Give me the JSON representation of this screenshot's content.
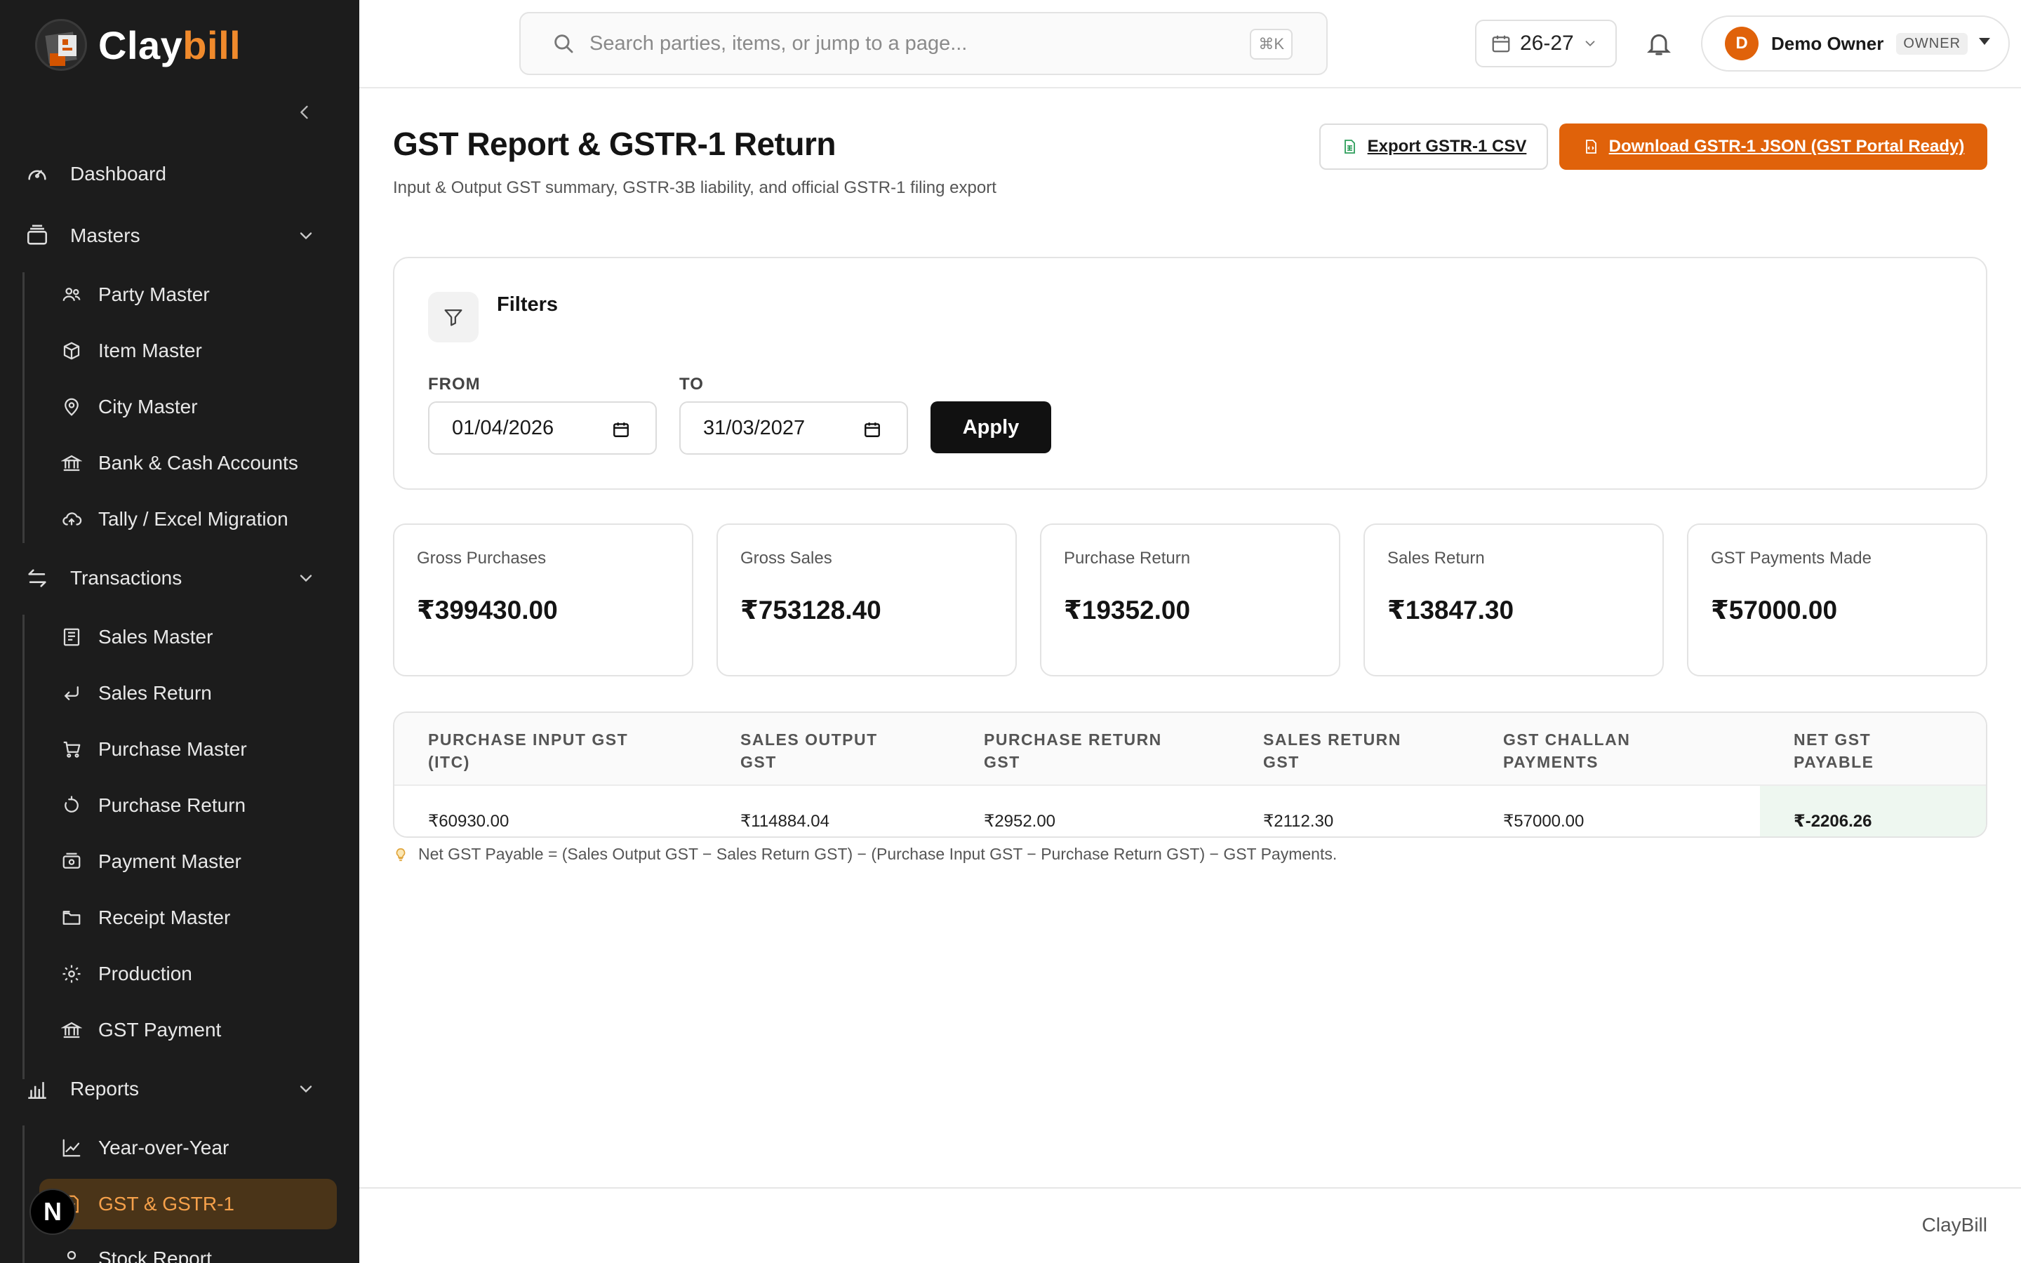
{
  "brand": {
    "name_part1": "Clay",
    "name_part2": "bill"
  },
  "sidebar": {
    "dashboard": "Dashboard",
    "masters": {
      "label": "Masters",
      "items": [
        "Party Master",
        "Item Master",
        "City Master",
        "Bank & Cash Accounts",
        "Tally / Excel Migration"
      ]
    },
    "transactions": {
      "label": "Transactions",
      "items": [
        "Sales Master",
        "Sales Return",
        "Purchase Master",
        "Purchase Return",
        "Payment Master",
        "Receipt Master",
        "Production",
        "GST Payment"
      ]
    },
    "reports": {
      "label": "Reports",
      "items": [
        "Year-over-Year",
        "GST & GSTR-1",
        "Stock Report"
      ]
    },
    "next_badge": "N"
  },
  "topbar": {
    "search_placeholder": "Search parties, items, or jump to a page...",
    "search_shortcut": "⌘K",
    "fiscal_year": "26-27",
    "user": {
      "initial": "D",
      "name": "Demo Owner",
      "role": "OWNER"
    }
  },
  "page": {
    "title": "GST Report & GSTR-1 Return",
    "subtitle": "Input & Output GST summary, GSTR-3B liability, and official GSTR-1 filing export",
    "export_csv_label": "Export GSTR-1 CSV",
    "download_json_label": "Download GSTR-1 JSON (GST Portal Ready)"
  },
  "filters": {
    "title": "Filters",
    "from_label": "FROM",
    "from_value": "01/04/2026",
    "to_label": "TO",
    "to_value": "31/03/2027",
    "apply_label": "Apply"
  },
  "summary_cards": [
    {
      "label": "Gross Purchases",
      "value": "₹399430.00"
    },
    {
      "label": "Gross Sales",
      "value": "₹753128.40"
    },
    {
      "label": "Purchase Return",
      "value": "₹19352.00"
    },
    {
      "label": "Sales Return",
      "value": "₹13847.30"
    },
    {
      "label": "GST Payments Made",
      "value": "₹57000.00"
    }
  ],
  "gst_table": {
    "headers": [
      [
        "PURCHASE INPUT GST",
        "(ITC)"
      ],
      [
        "SALES OUTPUT",
        "GST"
      ],
      [
        "PURCHASE RETURN",
        "GST"
      ],
      [
        "SALES RETURN",
        "GST"
      ],
      [
        "GST CHALLAN",
        "PAYMENTS"
      ],
      [
        "NET GST",
        "PAYABLE"
      ]
    ],
    "row": [
      "₹60930.00",
      "₹114884.04",
      "₹2952.00",
      "₹2112.30",
      "₹57000.00",
      "₹-2206.26"
    ]
  },
  "note": "Net GST Payable = (Sales Output GST − Sales Return GST) − (Purchase Input GST − Purchase Return GST) − GST Payments.",
  "footer": "ClayBill",
  "colors": {
    "accent": "#e0620a",
    "sidebar_bg": "#1c1c1c",
    "active_item_bg": "#4a3418",
    "active_item_text": "#f5a04a",
    "net_cell_bg": "#eef7f0"
  }
}
